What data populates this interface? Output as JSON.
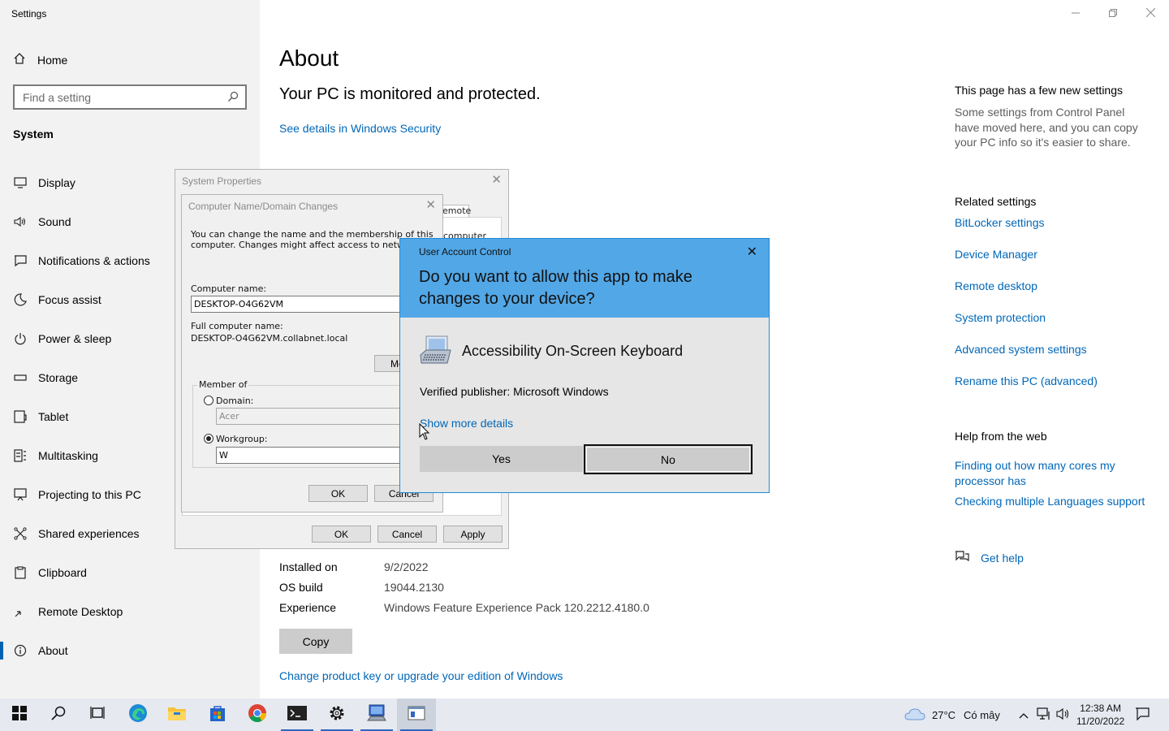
{
  "app": {
    "title": "Settings"
  },
  "sidebar": {
    "home": "Home",
    "search_placeholder": "Find a setting",
    "section": "System",
    "items": [
      {
        "label": "Display",
        "icon": "monitor-icon"
      },
      {
        "label": "Sound",
        "icon": "speaker-icon"
      },
      {
        "label": "Notifications & actions",
        "icon": "notification-icon"
      },
      {
        "label": "Focus assist",
        "icon": "moon-icon"
      },
      {
        "label": "Power & sleep",
        "icon": "power-icon"
      },
      {
        "label": "Storage",
        "icon": "storage-icon"
      },
      {
        "label": "Tablet",
        "icon": "tablet-icon"
      },
      {
        "label": "Multitasking",
        "icon": "multitasking-icon"
      },
      {
        "label": "Projecting to this PC",
        "icon": "projecting-icon"
      },
      {
        "label": "Shared experiences",
        "icon": "shared-icon"
      },
      {
        "label": "Clipboard",
        "icon": "clipboard-icon"
      },
      {
        "label": "Remote Desktop",
        "icon": "remote-desktop-icon"
      },
      {
        "label": "About",
        "icon": "info-icon"
      }
    ]
  },
  "main": {
    "title": "About",
    "protect": "Your PC is monitored and protected.",
    "security_link": "See details in Windows Security",
    "specs": [
      {
        "key": "Installed on",
        "value": "9/2/2022"
      },
      {
        "key": "OS build",
        "value": "19044.2130"
      },
      {
        "key": "Experience",
        "value": "Windows Feature Experience Pack 120.2212.4180.0"
      }
    ],
    "copy_label": "Copy",
    "change_link": "Change product key or upgrade your edition of Windows"
  },
  "right": {
    "new_title": "This page has a few new settings",
    "new_desc": "Some settings from Control Panel have moved here, and you can copy your PC info so it's easier to share.",
    "related_title": "Related settings",
    "related_links": [
      "BitLocker settings",
      "Device Manager",
      "Remote desktop",
      "System protection",
      "Advanced system settings",
      "Rename this PC (advanced)"
    ],
    "help_title": "Help from the web",
    "help_links": [
      "Finding out how many cores my processor has",
      "Checking multiple Languages support"
    ],
    "get_help": "Get help"
  },
  "system_properties": {
    "title": "System Properties",
    "tab_partial": "emote",
    "text_partial": "computer",
    "ok": "OK",
    "cancel": "Cancel",
    "apply": "Apply"
  },
  "name_changes": {
    "title": "Computer Name/Domain Changes",
    "desc_line1": "You can change the name and the membership of this",
    "desc_line2": "computer. Changes might affect access to network res",
    "computer_name_label": "Computer name:",
    "computer_name_value": "DESKTOP-O4G62VM",
    "full_name_label": "Full computer name:",
    "full_name_value": "DESKTOP-O4G62VM.collabnet.local",
    "more_partial": "Mo",
    "member_of": "Member of",
    "domain_label": "Domain:",
    "domain_value": "Acer",
    "workgroup_label": "Workgroup:",
    "workgroup_value": "W",
    "ok": "OK",
    "cancel": "Cancel"
  },
  "uac": {
    "title": "User Account Control",
    "question": "Do you want to allow this app to make changes to your device?",
    "app_name": "Accessibility On-Screen Keyboard",
    "publisher": "Verified publisher: Microsoft Windows",
    "more_details": "Show more details",
    "yes": "Yes",
    "no": "No"
  },
  "taskbar": {
    "weather": "27°C",
    "weather_desc": "Có mây",
    "time": "12:38 AM",
    "date": "11/20/2022"
  },
  "colors": {
    "accent": "#0067b8",
    "uac_header": "#52a7e6",
    "sidebar_bg": "#f2f2f2"
  }
}
